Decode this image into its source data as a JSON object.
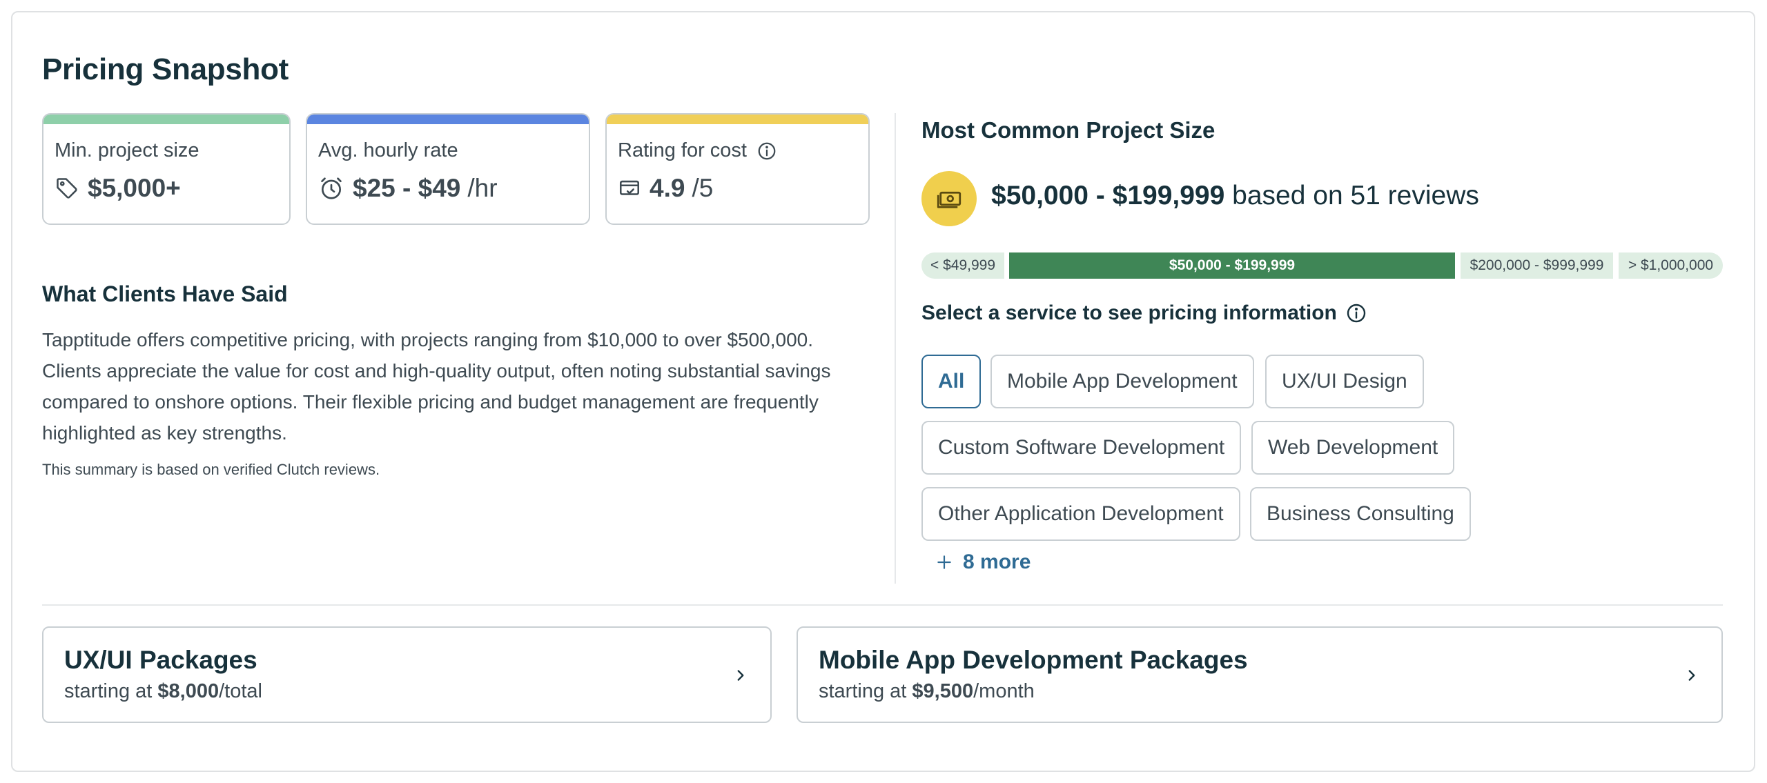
{
  "title": "Pricing Snapshot",
  "stats": {
    "min_project": {
      "label": "Min. project size",
      "value": "$5,000+",
      "unit": "",
      "accent": "#8ecfa9",
      "icon": "price-tag-icon"
    },
    "hourly": {
      "label": "Avg. hourly rate",
      "value": "$25 - $49",
      "unit": "/hr",
      "accent": "#5b85e0",
      "icon": "clock-icon"
    },
    "rating": {
      "label": "Rating for cost",
      "value": "4.9",
      "unit": "/5",
      "accent": "#f0cf58",
      "icon": "wallet-check-icon"
    }
  },
  "clients": {
    "heading": "What Clients Have Said",
    "summary": "Tapptitude offers competitive pricing, with projects ranging from $10,000 to over $500,000. Clients appreciate the value for cost and high-quality output, often noting substantial savings compared to onshore options. Their flexible pricing and budget management are frequently highlighted as key strengths.",
    "note": "This summary is based on verified Clutch reviews."
  },
  "common_size": {
    "heading": "Most Common Project Size",
    "range": "$50,000 - $199,999",
    "suffix": "based on 51 reviews",
    "icon": "cash-icon",
    "icon_bg": "#f0cf4d"
  },
  "size_bar": {
    "segments": [
      "< $49,999",
      "$50,000 - $199,999",
      "$200,000 - $999,999",
      "> $1,000,000"
    ],
    "active_index": 1,
    "active_color": "#3f8656",
    "inactive_color": "#dfeee3"
  },
  "services": {
    "heading": "Select a service to see pricing information",
    "chips": [
      "All",
      "Mobile App Development",
      "UX/UI Design",
      "Custom Software Development",
      "Web Development",
      "Other Application Development",
      "Business Consulting"
    ],
    "selected": "All",
    "more_label": "8 more"
  },
  "packages": [
    {
      "title": "UX/UI Packages",
      "prefix": "starting at ",
      "price": "$8,000",
      "period": "/total"
    },
    {
      "title": "Mobile App Development Packages",
      "prefix": "starting at ",
      "price": "$9,500",
      "period": "/month"
    }
  ],
  "colors": {
    "link": "#2f6b94",
    "text_dark": "#17313b",
    "text": "#3e4a52"
  }
}
